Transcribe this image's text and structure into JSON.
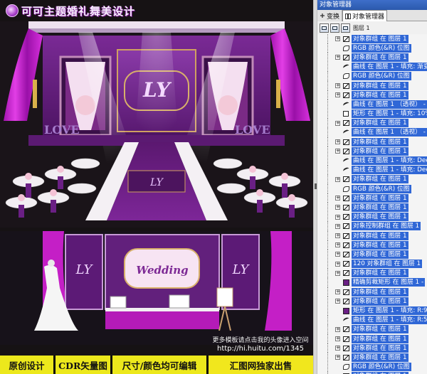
{
  "artwork": {
    "brand_title": "可可主题婚礼舞美设计",
    "stage_monogram": "LY",
    "wedding_script": "Wedding",
    "love_left": "LOVE",
    "love_right": "LOVE",
    "url_note": "更多模板请点击我的头像进入空间",
    "url": "http://hi.huitu.com/1345",
    "banner": [
      "原创设计",
      "CDR矢量图",
      "尺寸/颜色均可编辑",
      "汇图网独家出售"
    ],
    "colors": {
      "purple": "#6a1f84",
      "magenta": "#c21fc2",
      "banner_yellow": "#ece81c"
    }
  },
  "panel": {
    "title": "对象管理器",
    "tabs": [
      {
        "label": "变换",
        "active": false
      },
      {
        "label": "对象管理器",
        "active": true
      }
    ],
    "layer_label": "图层 1",
    "rows": [
      {
        "icon": "group",
        "text": "对象群组 在 图层 1",
        "selected": true
      },
      {
        "icon": "bitmap",
        "text": "RGB 颜色(&R) 位图",
        "selected": true
      },
      {
        "icon": "group",
        "text": "对象群组 在 图层 1",
        "selected": true
      },
      {
        "icon": "curve",
        "text": "曲线 在 图层 1 - 填充: 渐变",
        "selected": true
      },
      {
        "icon": "bitmap",
        "text": "RGB 颜色(&R) 位图",
        "selected": true
      },
      {
        "icon": "group",
        "text": "对象群组 在 图层 1",
        "selected": true
      },
      {
        "icon": "group",
        "text": "对象群组 在 图层 1",
        "selected": true
      },
      {
        "icon": "curve",
        "text": "曲线 在 图层 1 （透视） -",
        "selected": true
      },
      {
        "icon": "rect",
        "text": "矩形 在 图层 1 - 填充: 10%",
        "selected": true
      },
      {
        "icon": "group",
        "text": "对象群组 在 图层 1",
        "selected": true
      },
      {
        "icon": "curve",
        "text": "曲线 在 图层 1 （透视） -",
        "selected": true
      },
      {
        "icon": "group",
        "text": "对象群组 在 图层 1",
        "selected": true
      },
      {
        "icon": "group",
        "text": "对象群组 在 图层 1",
        "selected": true
      },
      {
        "icon": "curve",
        "text": "曲线 在 图层 1 - 填充: Dee",
        "selected": true
      },
      {
        "icon": "curve",
        "text": "曲线 在 图层 1 - 填充: Dee",
        "selected": true
      },
      {
        "icon": "group",
        "text": "对象群组 在 图层 1",
        "selected": true
      },
      {
        "icon": "bitmap",
        "text": "RGB 颜色(&R) 位图",
        "selected": true
      },
      {
        "icon": "group",
        "text": "对象群组 在 图层 1",
        "selected": true
      },
      {
        "icon": "group",
        "text": "对象群组 在 图层 1",
        "selected": true
      },
      {
        "icon": "group",
        "text": "对象群组 在 图层 1",
        "selected": true
      },
      {
        "icon": "group",
        "text": "对象控制群组 在 图层 1",
        "selected": true
      },
      {
        "icon": "group",
        "text": "对象群组 在 图层 1",
        "selected": true
      },
      {
        "icon": "group",
        "text": "对象群组 在 图层 1",
        "selected": true
      },
      {
        "icon": "group",
        "text": "对象群组 在 图层 1",
        "selected": true
      },
      {
        "icon": "group",
        "text": "120 对象群组 在 图层 1",
        "selected": true
      },
      {
        "icon": "group",
        "text": "对象群组 在 图层 1",
        "selected": true
      },
      {
        "icon": "fillrect",
        "text": "精确剪裁矩形 在 图层 1 -",
        "selected": true
      },
      {
        "icon": "group",
        "text": "对象群组 在 图层 1",
        "selected": true
      },
      {
        "icon": "group",
        "text": "对象群组 在 图层 1",
        "selected": true
      },
      {
        "icon": "fillrect",
        "text": "矩形 在 图层 1 - 填充: R:9",
        "selected": true
      },
      {
        "icon": "curve",
        "text": "曲线 在 图层 1 - 填充: R:5",
        "selected": true
      },
      {
        "icon": "group",
        "text": "对象群组 在 图层 1",
        "selected": true
      },
      {
        "icon": "group",
        "text": "对象群组 在 图层 1",
        "selected": true
      },
      {
        "icon": "group",
        "text": "对象群组 在 图层 1",
        "selected": true
      },
      {
        "icon": "group",
        "text": "对象群组 在 图层 1",
        "selected": true
      },
      {
        "icon": "bitmap",
        "text": "RGB 颜色(&R) 位图",
        "selected": true
      },
      {
        "icon": "group",
        "text": "对象群组 在 图层 1",
        "selected": true
      }
    ]
  }
}
